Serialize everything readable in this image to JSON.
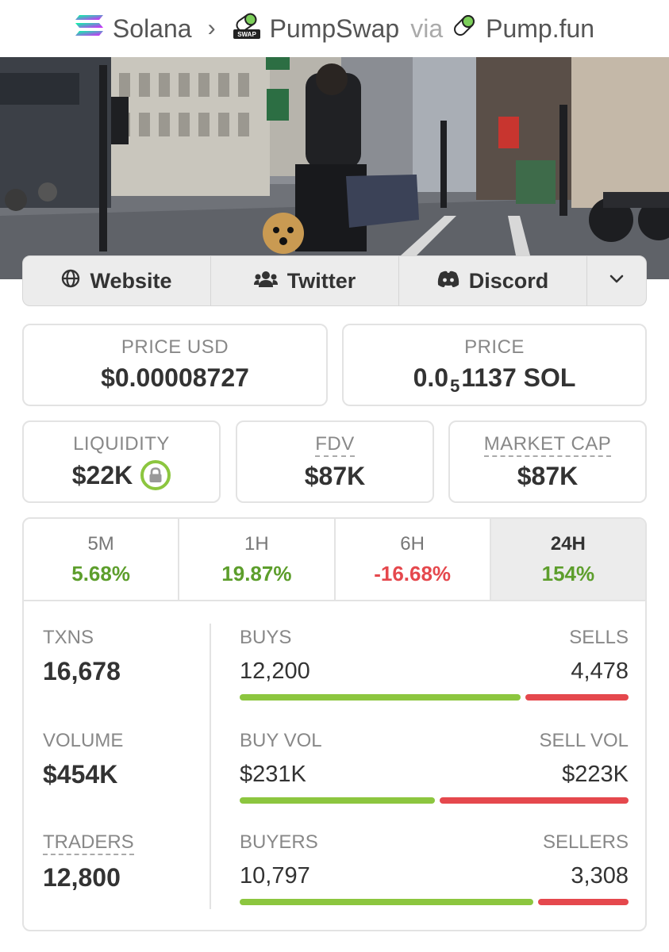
{
  "breadcrumb": {
    "chain": "Solana",
    "dex": "PumpSwap",
    "via_label": "via",
    "launchpad": "Pump.fun",
    "swap_badge": "SWAP"
  },
  "socials": {
    "website": "Website",
    "twitter": "Twitter",
    "discord": "Discord"
  },
  "price": {
    "usd_label": "PRICE USD",
    "usd_value": "$0.00008727",
    "native_label": "PRICE",
    "native_prefix": "0.0",
    "native_zeros": "5",
    "native_digits": "1137 SOL"
  },
  "metrics": {
    "liquidity_label": "LIQUIDITY",
    "liquidity_value": "$22K",
    "fdv_label": "FDV",
    "fdv_value": "$87K",
    "mcap_label": "MARKET CAP",
    "mcap_value": "$87K"
  },
  "periods": [
    {
      "label": "5M",
      "change": "5.68%",
      "direction": "up"
    },
    {
      "label": "1H",
      "change": "19.87%",
      "direction": "up"
    },
    {
      "label": "6H",
      "change": "-16.68%",
      "direction": "down"
    },
    {
      "label": "24H",
      "change": "154%",
      "direction": "up",
      "selected": true
    }
  ],
  "stats": {
    "txns_label": "TXNS",
    "txns_value": "16,678",
    "volume_label": "VOLUME",
    "volume_value": "$454K",
    "traders_label": "TRADERS",
    "traders_value": "12,800",
    "buys_label": "BUYS",
    "buys_value": "12,200",
    "sells_label": "SELLS",
    "sells_value": "4,478",
    "buys_ratio": 0.732,
    "buy_vol_label": "BUY VOL",
    "buy_vol_value": "$231K",
    "sell_vol_label": "SELL VOL",
    "sell_vol_value": "$223K",
    "buy_vol_ratio": 0.509,
    "buyers_label": "BUYERS",
    "buyers_value": "10,797",
    "sellers_label": "SELLERS",
    "sellers_value": "3,308",
    "buyers_ratio": 0.765
  },
  "colors": {
    "positive": "#5d9e2c",
    "negative": "#e5484d",
    "buy_bar": "#8cc63f",
    "sell_bar": "#e5484d"
  }
}
